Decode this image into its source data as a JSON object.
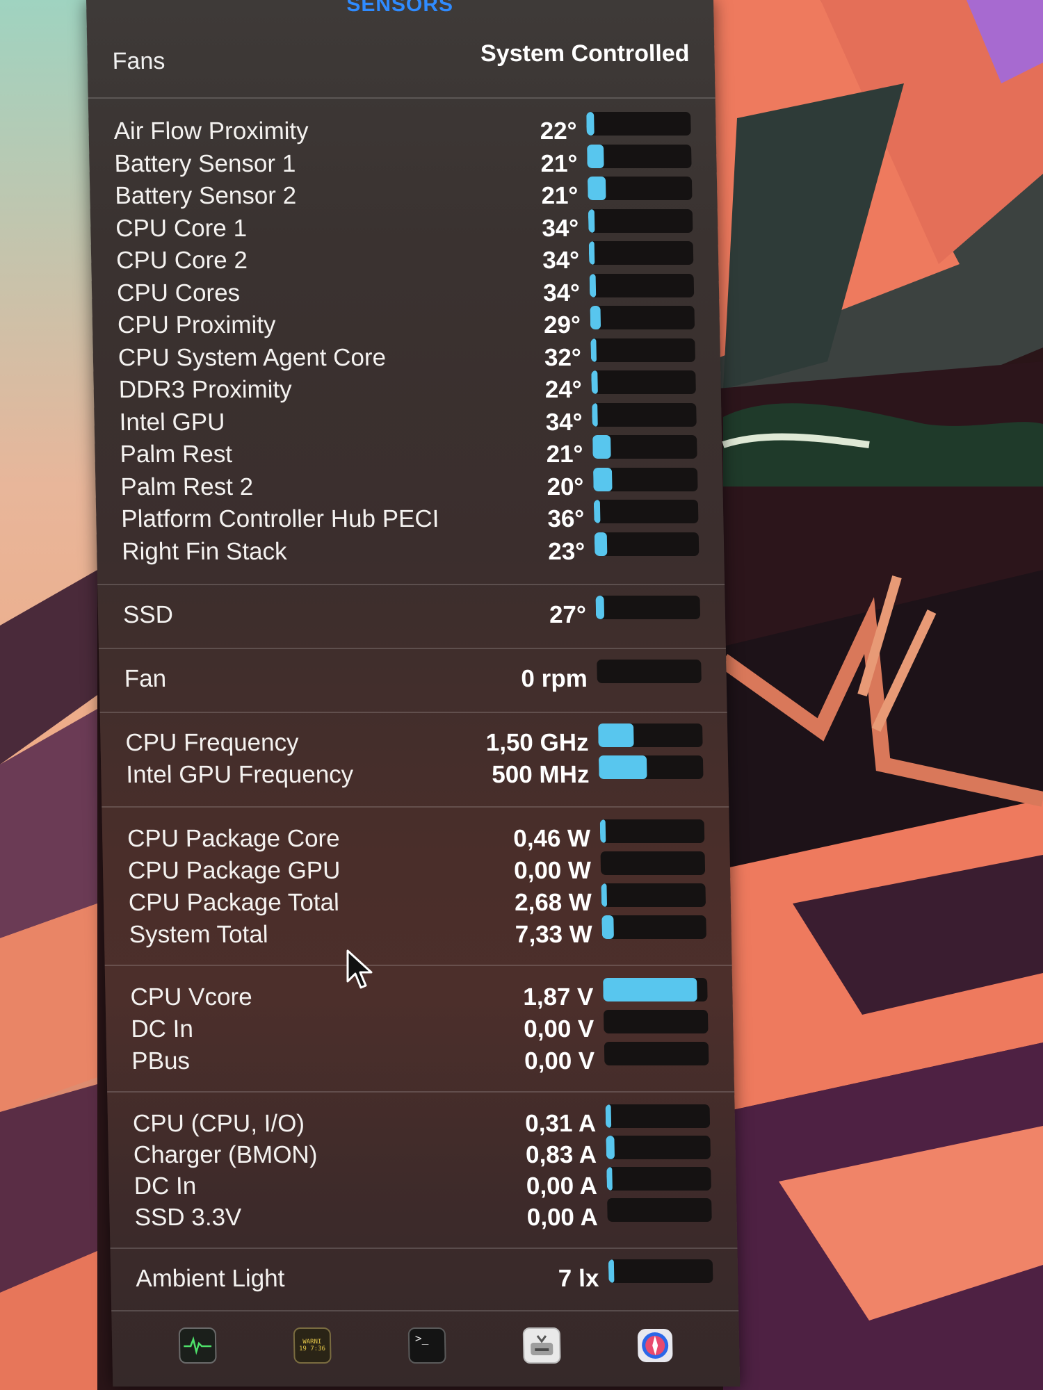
{
  "panel": {
    "title": "SENSORS"
  },
  "fans_header": {
    "label": "Fans",
    "mode": "System Controlled"
  },
  "temperatures": [
    {
      "label": "Air Flow Proximity",
      "value": "22°",
      "level": 0.07
    },
    {
      "label": "Battery Sensor 1",
      "value": "21°",
      "level": 0.16
    },
    {
      "label": "Battery Sensor 2",
      "value": "21°",
      "level": 0.17
    },
    {
      "label": "CPU Core 1",
      "value": "34°",
      "level": 0.06
    },
    {
      "label": "CPU Core 2",
      "value": "34°",
      "level": 0.05
    },
    {
      "label": "CPU Cores",
      "value": "34°",
      "level": 0.06
    },
    {
      "label": "CPU Proximity",
      "value": "29°",
      "level": 0.1
    },
    {
      "label": "CPU System Agent Core",
      "value": "32°",
      "level": 0.04
    },
    {
      "label": "DDR3 Proximity",
      "value": "24°",
      "level": 0.06
    },
    {
      "label": "Intel GPU",
      "value": "34°",
      "level": 0.05
    },
    {
      "label": "Palm Rest",
      "value": "21°",
      "level": 0.17
    },
    {
      "label": "Palm Rest 2",
      "value": "20°",
      "level": 0.18
    },
    {
      "label": "Platform Controller Hub PECI",
      "value": "36°",
      "level": 0.06
    },
    {
      "label": "Right Fin Stack",
      "value": "23°",
      "level": 0.12
    }
  ],
  "ssd": {
    "label": "SSD",
    "value": "27°",
    "level": 0.08
  },
  "fan": {
    "label": "Fan",
    "value": "0 rpm",
    "level": 0
  },
  "frequencies": [
    {
      "label": "CPU Frequency",
      "value": "1,50 GHz",
      "level": 0.34
    },
    {
      "label": "Intel GPU Frequency",
      "value": "500 MHz",
      "level": 0.46
    }
  ],
  "power": [
    {
      "label": "CPU Package Core",
      "value": "0,46 W",
      "level": 0.03
    },
    {
      "label": "CPU Package GPU",
      "value": "0,00 W",
      "level": 0.0
    },
    {
      "label": "CPU Package Total",
      "value": "2,68 W",
      "level": 0.04
    },
    {
      "label": "System Total",
      "value": "7,33 W",
      "level": 0.11
    }
  ],
  "voltage": [
    {
      "label": "CPU Vcore",
      "value": "1,87 V",
      "level": 0.9
    },
    {
      "label": "DC In",
      "value": "0,00 V",
      "level": 0.0
    },
    {
      "label": "PBus",
      "value": "0,00 V",
      "level": 0.0
    }
  ],
  "current": [
    {
      "label": "CPU (CPU, I/O)",
      "value": "0,31 A",
      "level": 0.02
    },
    {
      "label": "Charger (BMON)",
      "value": "0,83 A",
      "level": 0.08
    },
    {
      "label": "DC In",
      "value": "0,00 A",
      "level": 0.02
    },
    {
      "label": "SSD 3.3V",
      "value": "0,00 A",
      "level": 0.0
    }
  ],
  "light": {
    "label": "Ambient Light",
    "value": "7 lx",
    "level": 0.02
  },
  "toolbar": {
    "icons": [
      "activity-monitor-icon",
      "console-icon",
      "terminal-icon",
      "disk-utility-icon",
      "safari-icon"
    ],
    "console_text": "WARNI\n19 7:36"
  },
  "colors": {
    "accent": "#2f8bff",
    "bar_fill": "#58c6ee",
    "bar_track": "#151212"
  }
}
